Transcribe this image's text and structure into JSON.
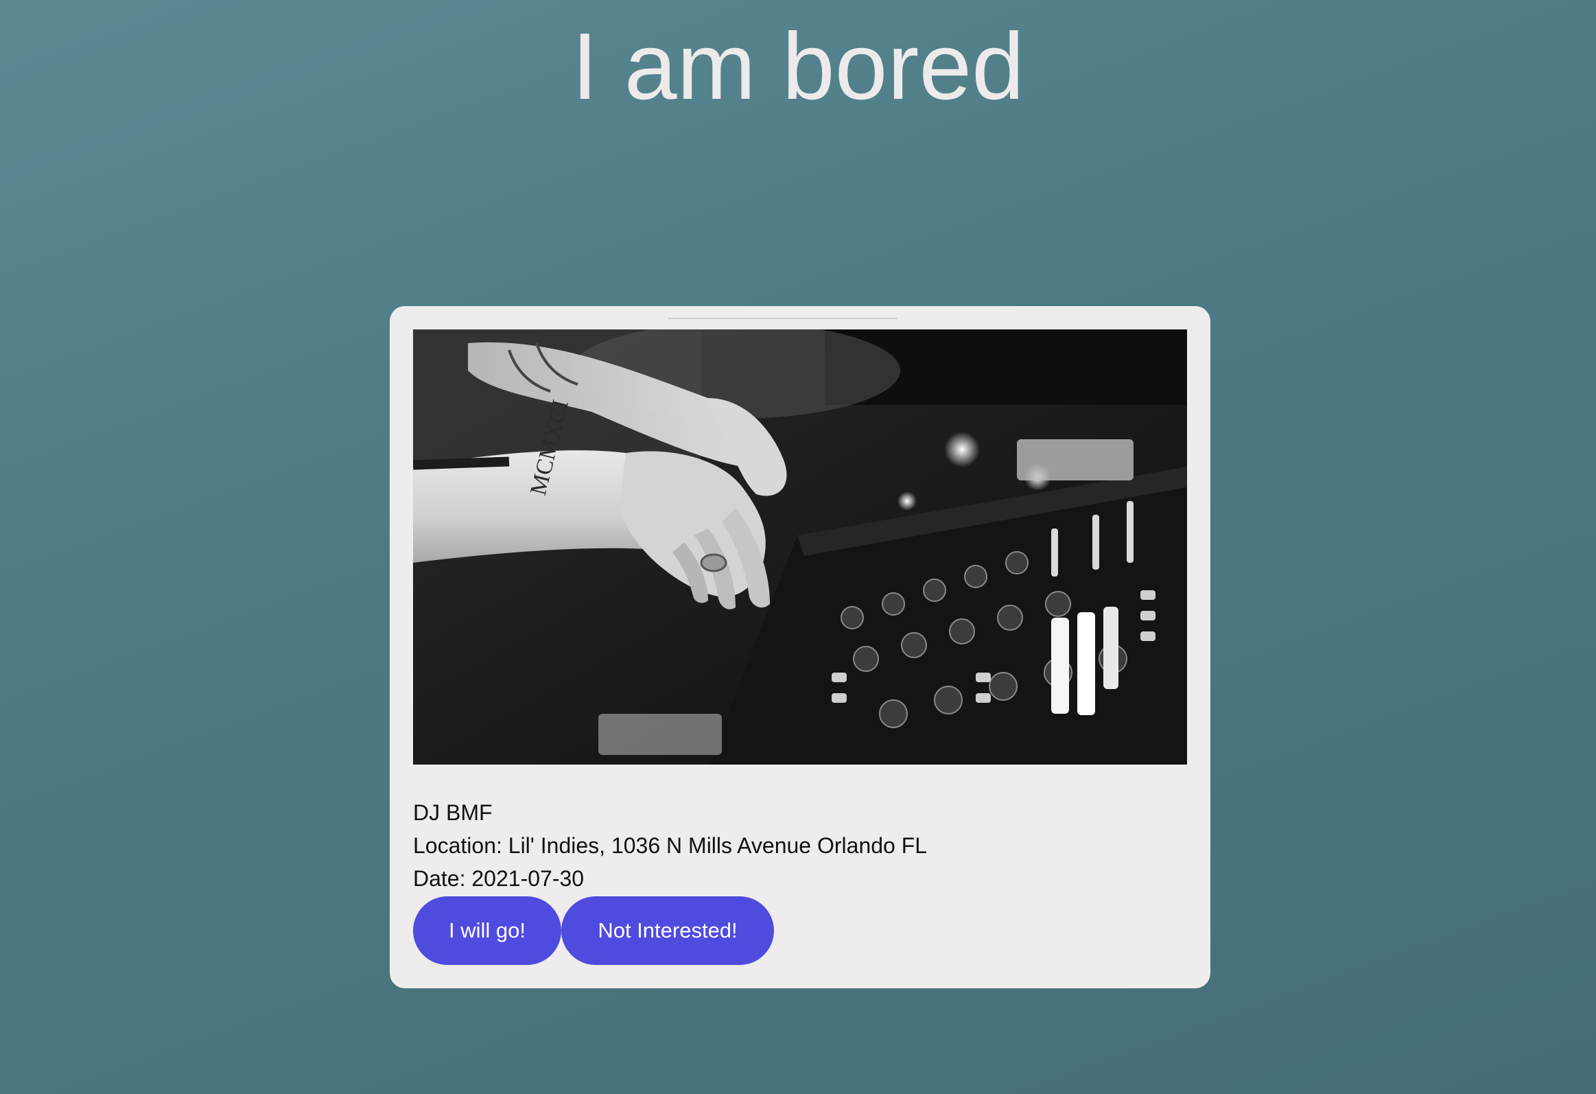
{
  "page": {
    "title": "I am bored"
  },
  "event": {
    "name": "DJ BMF",
    "location": "Location: Lil' Indies, 1036 N Mills Avenue Orlando FL",
    "date": "Date: 2021-07-30",
    "image_subject": "Black-and-white photo of hands adjusting knobs on a DJ mixer; wrist tattoo reads MCMXCI"
  },
  "actions": {
    "go_label": "I will go!",
    "decline_label": "Not Interested!"
  },
  "colors": {
    "background": "#4f7d87",
    "card": "#eeecec",
    "button": "#4f4bdf",
    "title_text": "#eceaea"
  }
}
